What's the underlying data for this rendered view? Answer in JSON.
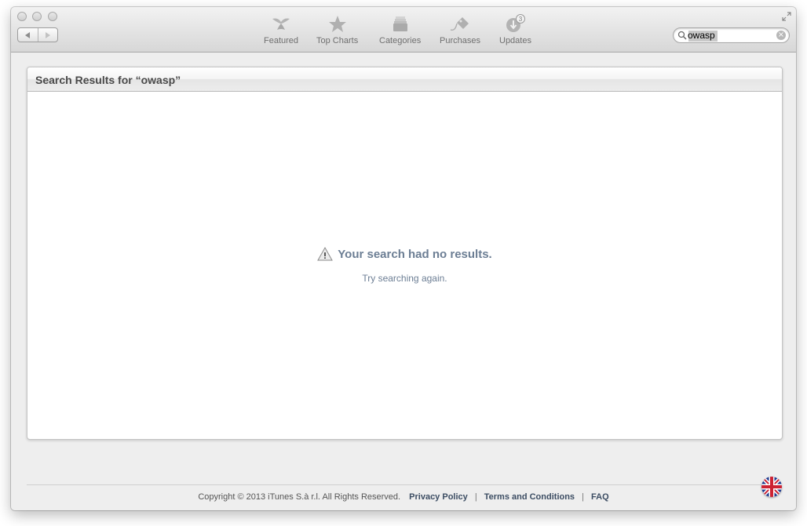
{
  "toolbar": {
    "items": [
      {
        "label": "Featured",
        "icon": "featured-icon"
      },
      {
        "label": "Top Charts",
        "icon": "star-icon"
      },
      {
        "label": "Categories",
        "icon": "categories-icon"
      },
      {
        "label": "Purchases",
        "icon": "purchases-icon"
      },
      {
        "label": "Updates",
        "icon": "updates-icon",
        "badge": "3"
      }
    ]
  },
  "search": {
    "value": "owasp"
  },
  "results": {
    "title": "Search Results for “owasp”",
    "empty_title": "Your search had no results.",
    "empty_subtitle": "Try searching again."
  },
  "footer": {
    "copyright": "Copyright © 2013 iTunes S.à r.l. All Rights Reserved.",
    "privacy": "Privacy Policy",
    "terms": "Terms and Conditions",
    "faq": "FAQ",
    "separator": "|"
  },
  "colors": {
    "accent_text": "#6c7e94",
    "footer_link": "#3c4d63"
  }
}
